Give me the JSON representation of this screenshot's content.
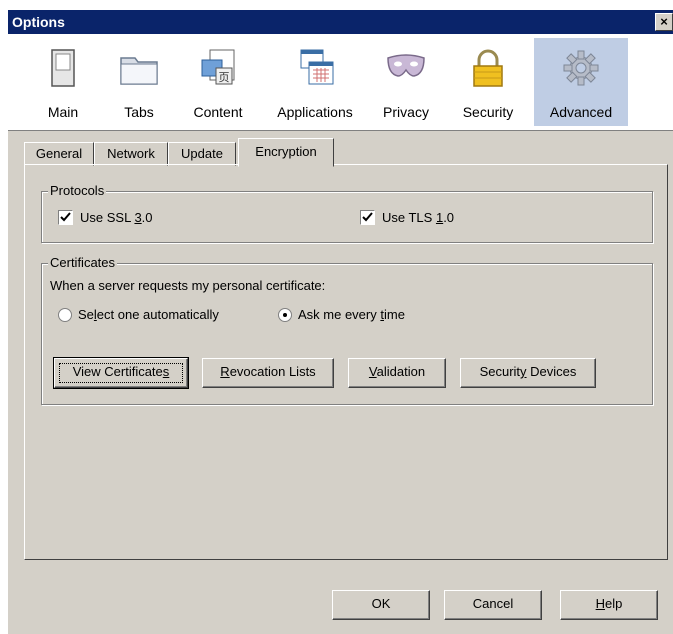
{
  "window": {
    "title": "Options",
    "close_glyph": "×"
  },
  "toolbar": {
    "items": [
      {
        "label": "Main",
        "icon": "switch-icon"
      },
      {
        "label": "Tabs",
        "icon": "tabs-icon"
      },
      {
        "label": "Content",
        "icon": "content-icon"
      },
      {
        "label": "Applications",
        "icon": "applications-icon"
      },
      {
        "label": "Privacy",
        "icon": "mask-icon"
      },
      {
        "label": "Security",
        "icon": "lock-icon"
      },
      {
        "label": "Advanced",
        "icon": "gear-icon",
        "active": true
      }
    ]
  },
  "subtabs": [
    "General",
    "Network",
    "Update",
    "Encryption"
  ],
  "protocols": {
    "legend": "Protocols",
    "ssl": {
      "pre": "Use SSL ",
      "key": "3",
      "post": ".0",
      "checked": true
    },
    "tls": {
      "pre": "Use TLS ",
      "key": "1",
      "post": ".0",
      "checked": true
    }
  },
  "certificates": {
    "legend": "Certificates",
    "prompt": "When a server requests my personal certificate:",
    "auto": {
      "pre": "Se",
      "key": "l",
      "post": "ect one automatically",
      "selected": false
    },
    "ask": {
      "pre": "Ask me every ",
      "key": "t",
      "post": "ime",
      "selected": true
    },
    "buttons": {
      "view": {
        "pre": "View Certificate",
        "key": "s",
        "post": ""
      },
      "revocation": {
        "pre": "",
        "key": "R",
        "post": "evocation Lists"
      },
      "validation": {
        "pre": "",
        "key": "V",
        "post": "alidation"
      },
      "devices": {
        "pre": "Securit",
        "key": "y",
        "post": " Devices"
      }
    }
  },
  "footer": {
    "ok": "OK",
    "cancel": "Cancel",
    "help": {
      "pre": "",
      "key": "H",
      "post": "elp"
    }
  },
  "colors": {
    "titlebar": "#0a246a",
    "face": "#d4d0c8",
    "active_tab_bg": "#bfcde4"
  }
}
